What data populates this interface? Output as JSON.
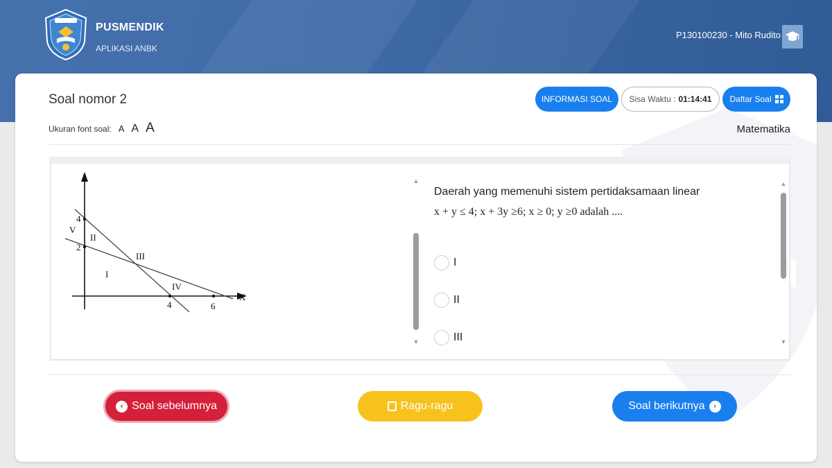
{
  "header": {
    "brand_title": "PUSMENDIK",
    "brand_subtitle": "APLIKASI ANBK",
    "user": "P130100230 - Mito Rudito",
    "avatar_icon": "graduation-cap-icon"
  },
  "question": {
    "title": "Soal nomor 2",
    "font_size_label": "Ukuran font soal:",
    "font_options": [
      "A",
      "A",
      "A"
    ],
    "subject": "Matematika",
    "text_line1": "Daerah yang memenuhi sistem pertidaksamaan linear",
    "text_line2": "x + y ≤ 4; x + 3y ≥6; x ≥ 0; y ≥0 adalah ....",
    "options": [
      "I",
      "II",
      "III"
    ],
    "graph_labels": {
      "x_axis": "X",
      "x_ticks": [
        "4",
        "6"
      ],
      "y_ticks": [
        "4",
        "2"
      ],
      "regions": [
        "V",
        "II",
        "III",
        "I",
        "IV"
      ]
    }
  },
  "toolbar": {
    "info_label": "INFORMASI SOAL",
    "timer_label": "Sisa Waktu :",
    "timer_value": "01:14:41",
    "daftar_label": "Daftar Soal"
  },
  "navigation": {
    "prev_label": "Soal sebelumnya",
    "doubt_label": "Ragu-ragu",
    "next_label": "Soal berikutnya"
  },
  "colors": {
    "header_blue": "#3f6aa5",
    "primary_blue": "#1a7fee",
    "danger_red": "#d4203a",
    "warning_yellow": "#f7c21c"
  }
}
